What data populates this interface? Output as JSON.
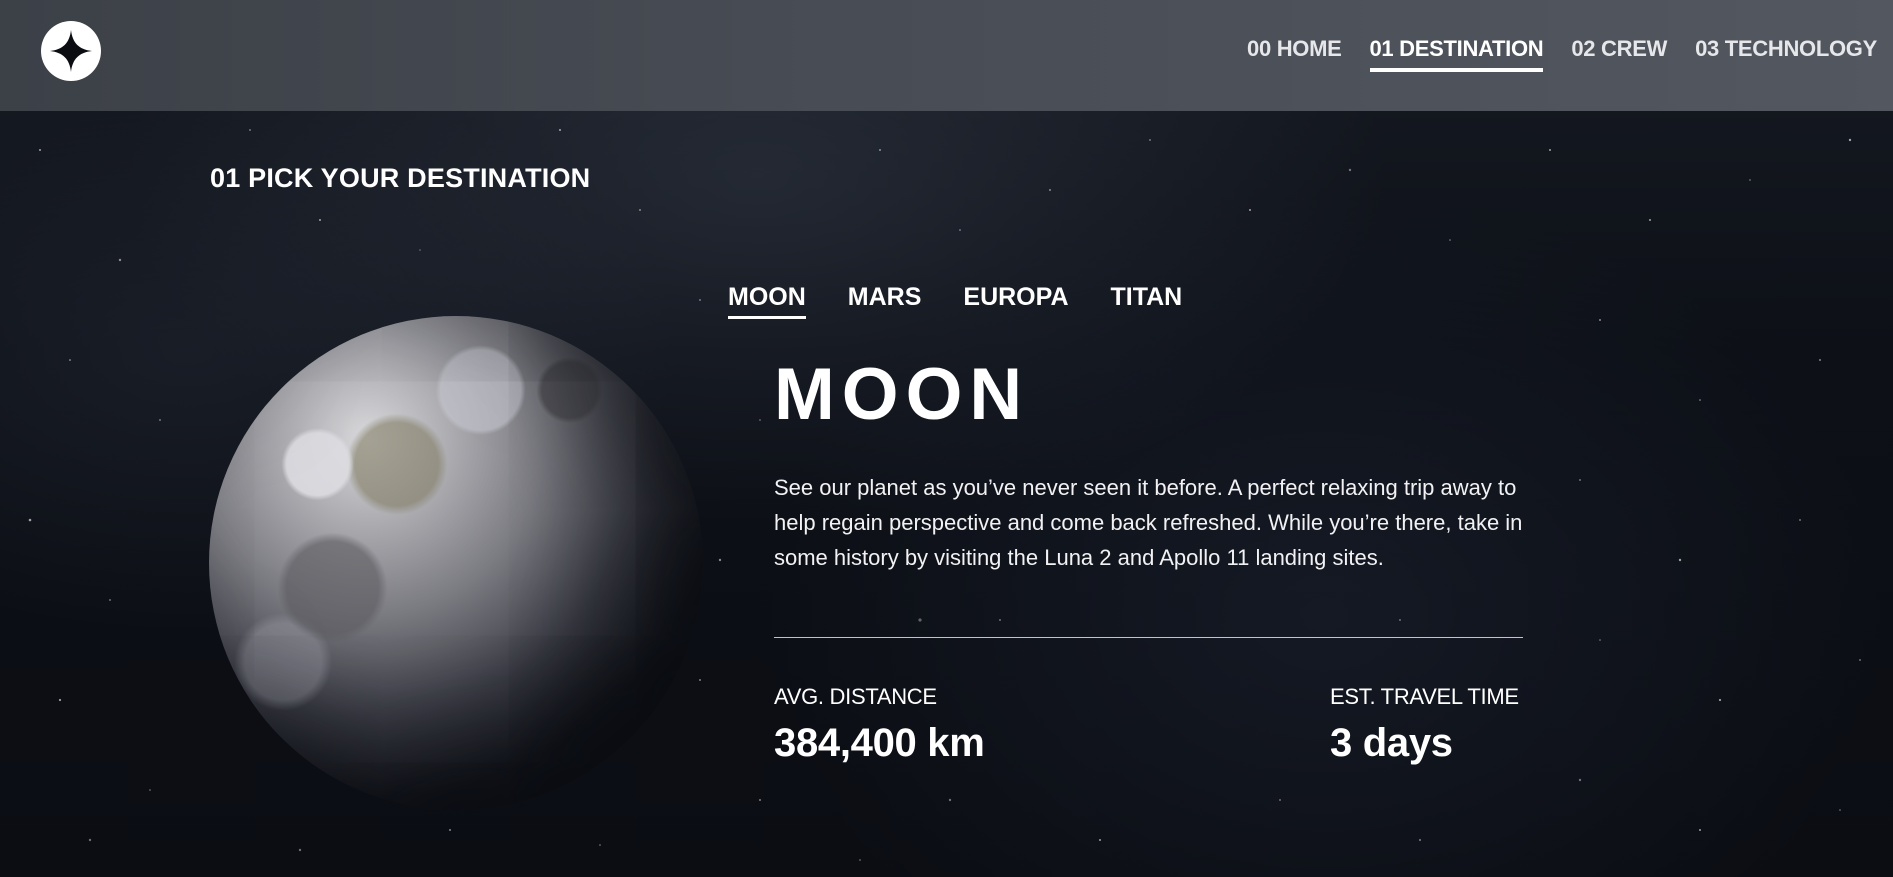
{
  "header": {
    "logo_icon": "star-logo-icon",
    "nav": [
      {
        "number": "00",
        "label": "HOME",
        "text": "00 HOME",
        "active": false
      },
      {
        "number": "01",
        "label": "DESTINATION",
        "text": "01 DESTINATION",
        "active": true
      },
      {
        "number": "02",
        "label": "CREW",
        "text": "02 CREW",
        "active": false
      },
      {
        "number": "03",
        "label": "TECHNOLOGY",
        "text": "03 TECHNOLOGY",
        "active": false
      }
    ]
  },
  "page": {
    "heading": "01 PICK YOUR DESTINATION"
  },
  "tabs": [
    {
      "label": "MOON",
      "active": true
    },
    {
      "label": "MARS",
      "active": false
    },
    {
      "label": "EUROPA",
      "active": false
    },
    {
      "label": "TITAN",
      "active": false
    }
  ],
  "destination": {
    "name": "MOON",
    "description": "See our planet as you’ve never seen it before. A perfect relaxing trip away to help regain perspective and come back refreshed. While you’re there, take in some history by visiting the Luna 2 and Apollo 11 landing sites.",
    "distance_label": "AVG. DISTANCE",
    "distance_value": "384,400 km",
    "travel_label": "EST. TRAVEL TIME",
    "travel_value": "3 days"
  },
  "colors": {
    "background": "#0b0d13",
    "header": "#474b53",
    "text": "#ffffff"
  }
}
